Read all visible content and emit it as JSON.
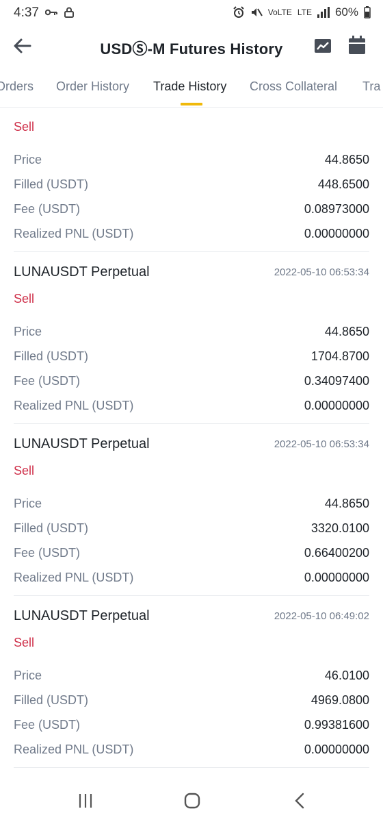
{
  "status_bar": {
    "time": "4:37",
    "network": "LTE",
    "battery": "60%"
  },
  "header": {
    "title": "USDⓈ-M Futures History"
  },
  "tabs": [
    {
      "label": "Orders"
    },
    {
      "label": "Order History"
    },
    {
      "label": "Trade History"
    },
    {
      "label": "Cross Collateral"
    },
    {
      "label": "Tra"
    }
  ],
  "active_tab": "Trade History",
  "row_labels": {
    "price": "Price",
    "filled": "Filled (USDT)",
    "fee": "Fee (USDT)",
    "pnl": "Realized PNL (USDT)"
  },
  "trades": [
    {
      "symbol": "",
      "time": "",
      "side": "Sell",
      "price": "44.8650",
      "filled": "448.6500",
      "fee": "0.08973000",
      "pnl": "0.00000000"
    },
    {
      "symbol": "LUNAUSDT Perpetual",
      "time": "2022-05-10 06:53:34",
      "side": "Sell",
      "price": "44.8650",
      "filled": "1704.8700",
      "fee": "0.34097400",
      "pnl": "0.00000000"
    },
    {
      "symbol": "LUNAUSDT Perpetual",
      "time": "2022-05-10 06:53:34",
      "side": "Sell",
      "price": "44.8650",
      "filled": "3320.0100",
      "fee": "0.66400200",
      "pnl": "0.00000000"
    },
    {
      "symbol": "LUNAUSDT Perpetual",
      "time": "2022-05-10 06:49:02",
      "side": "Sell",
      "price": "46.0100",
      "filled": "4969.0800",
      "fee": "0.99381600",
      "pnl": "0.00000000"
    }
  ],
  "colors": {
    "sell": "#cf304a",
    "accent": "#f0b90b",
    "label": "#707a8a",
    "text": "#1e2329"
  }
}
